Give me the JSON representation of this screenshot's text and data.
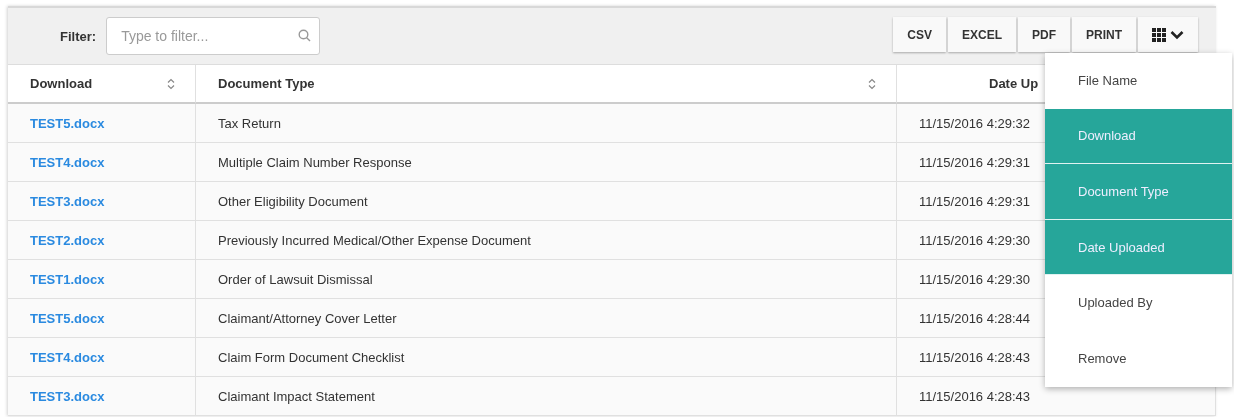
{
  "toolbar": {
    "filter_label": "Filter:",
    "filter": {
      "placeholder": "Type to filter..."
    },
    "buttons": [
      "CSV",
      "EXCEL",
      "PDF",
      "PRINT"
    ]
  },
  "table": {
    "columns": [
      {
        "label": "Download",
        "sortable": true
      },
      {
        "label": "Document Type",
        "sortable": true
      },
      {
        "label": "Date Up"
      }
    ],
    "rows": [
      {
        "file": "TEST5.docx",
        "type": "Tax Return",
        "date": "11/15/2016 4:29:32"
      },
      {
        "file": "TEST4.docx",
        "type": "Multiple Claim Number Response",
        "date": "11/15/2016 4:29:31"
      },
      {
        "file": "TEST3.docx",
        "type": "Other Eligibility Document",
        "date": "11/15/2016 4:29:31"
      },
      {
        "file": "TEST2.docx",
        "type": "Previously Incurred Medical/Other Expense Document",
        "date": "11/15/2016 4:29:30"
      },
      {
        "file": "TEST1.docx",
        "type": "Order of Lawsuit Dismissal",
        "date": "11/15/2016 4:29:30"
      },
      {
        "file": "TEST5.docx",
        "type": "Claimant/Attorney Cover Letter",
        "date": "11/15/2016 4:28:44"
      },
      {
        "file": "TEST4.docx",
        "type": "Claim Form Document Checklist",
        "date": "11/15/2016 4:28:43"
      },
      {
        "file": "TEST3.docx",
        "type": "Claimant Impact Statement",
        "date": "11/15/2016 4:28:43"
      }
    ]
  },
  "column_menu": {
    "items": [
      {
        "label": "File Name",
        "selected": false
      },
      {
        "label": "Download",
        "selected": true
      },
      {
        "label": "Document Type",
        "selected": true
      },
      {
        "label": "Date Uploaded",
        "selected": true
      },
      {
        "label": "Uploaded By",
        "selected": false
      },
      {
        "label": "Remove",
        "selected": false
      }
    ]
  }
}
